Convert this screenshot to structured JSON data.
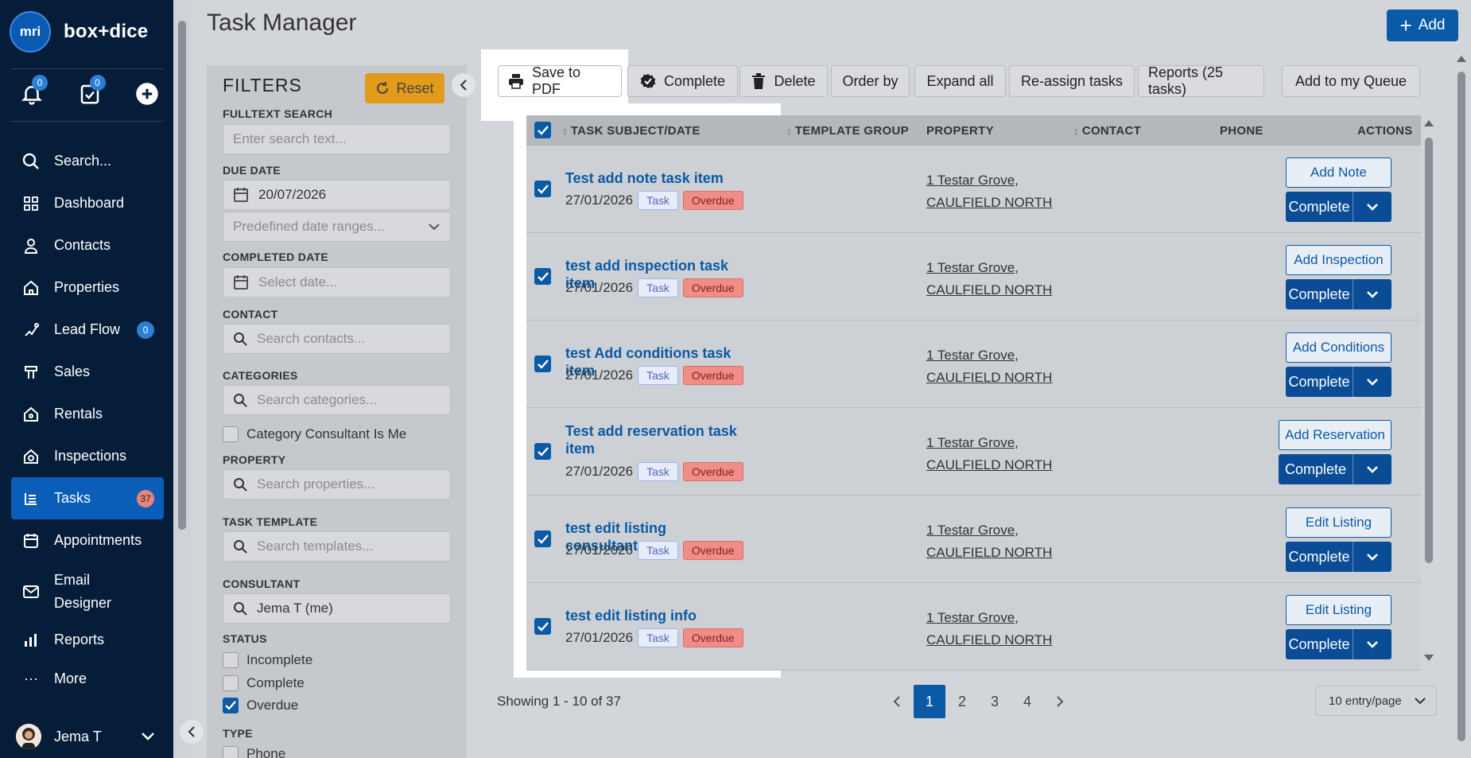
{
  "brand": {
    "logo_text": "mri",
    "name": "box+dice"
  },
  "quick_actions": {
    "notifications_count": "0",
    "tasks_count": "0"
  },
  "nav": [
    {
      "label": "Search...",
      "icon": "search-icon"
    },
    {
      "label": "Dashboard",
      "icon": "grid-icon"
    },
    {
      "label": "Contacts",
      "icon": "person-icon"
    },
    {
      "label": "Properties",
      "icon": "home-icon"
    },
    {
      "label": "Lead Flow",
      "icon": "flow-icon",
      "badge": "0"
    },
    {
      "label": "Sales",
      "icon": "sales-icon"
    },
    {
      "label": "Rentals",
      "icon": "rentals-icon"
    },
    {
      "label": "Inspections",
      "icon": "inspection-icon"
    },
    {
      "label": "Tasks",
      "icon": "tasks-icon",
      "badge": "37",
      "active": true
    },
    {
      "label": "Appointments",
      "icon": "calendar-icon"
    },
    {
      "label": "Email Designer",
      "icon": "mail-icon"
    },
    {
      "label": "Reports",
      "icon": "bar-chart-icon"
    },
    {
      "label": "More",
      "icon": "dots-icon"
    }
  ],
  "user": {
    "name": "Jema T"
  },
  "header": {
    "title": "Task Manager",
    "add_label": "Add"
  },
  "filters": {
    "title": "FILTERS",
    "reset_label": "Reset",
    "fulltext_label": "FULLTEXT SEARCH",
    "fulltext_placeholder": "Enter search text...",
    "due_date_label": "DUE DATE",
    "due_date_value": "20/07/2026",
    "predefined_placeholder": "Predefined date ranges...",
    "completed_date_label": "COMPLETED DATE",
    "completed_date_placeholder": "Select date...",
    "contact_label": "CONTACT",
    "contact_placeholder": "Search contacts...",
    "categories_label": "CATEGORIES",
    "categories_placeholder": "Search categories...",
    "category_consultant_label": "Category Consultant Is Me",
    "property_label": "PROPERTY",
    "property_placeholder": "Search properties...",
    "template_label": "TASK TEMPLATE",
    "template_placeholder": "Search templates...",
    "consultant_label": "CONSULTANT",
    "consultant_value": "Jema T (me)",
    "status_label": "STATUS",
    "status_options": [
      "Incomplete",
      "Complete",
      "Overdue"
    ],
    "status_checked": [
      false,
      false,
      true
    ],
    "type_label": "TYPE",
    "type_first": "Phone"
  },
  "toolbar": {
    "save_pdf": "Save to PDF",
    "complete": "Complete",
    "delete": "Delete",
    "order_by": "Order by",
    "expand_all": "Expand all",
    "reassign": "Re-assign tasks",
    "reports": "Reports (25 tasks)",
    "queue": "Add to my Queue"
  },
  "table": {
    "columns": [
      "TASK SUBJECT/DATE",
      "TEMPLATE GROUP",
      "PROPERTY",
      "CONTACT",
      "PHONE",
      "ACTIONS"
    ],
    "rows": [
      {
        "subject": "Test add note task item",
        "date": "27/01/2026",
        "tag": "Task",
        "status": "Overdue",
        "prop1": "1 Testar Grove,",
        "prop2": "CAULFIELD NORTH",
        "action": "Add Note",
        "complete": "Complete"
      },
      {
        "subject": "test add inspection task item",
        "date": "27/01/2026",
        "tag": "Task",
        "status": "Overdue",
        "prop1": "1 Testar Grove,",
        "prop2": "CAULFIELD NORTH",
        "action": "Add Inspection",
        "complete": "Complete"
      },
      {
        "subject": "test Add conditions task item",
        "date": "27/01/2026",
        "tag": "Task",
        "status": "Overdue",
        "prop1": "1 Testar Grove,",
        "prop2": "CAULFIELD NORTH",
        "action": "Add Conditions",
        "complete": "Complete"
      },
      {
        "subject": "Test add reservation task item",
        "date": "27/01/2026",
        "tag": "Task",
        "status": "Overdue",
        "prop1": "1 Testar Grove,",
        "prop2": "CAULFIELD NORTH",
        "action": "Add Reservation",
        "complete": "Complete"
      },
      {
        "subject": "test edit listing consultants",
        "date": "27/01/2026",
        "tag": "Task",
        "status": "Overdue",
        "prop1": "1 Testar Grove,",
        "prop2": "CAULFIELD NORTH",
        "action": "Edit Listing",
        "complete": "Complete"
      },
      {
        "subject": "test edit listing info",
        "date": "27/01/2026",
        "tag": "Task",
        "status": "Overdue",
        "prop1": "1 Testar Grove,",
        "prop2": "CAULFIELD NORTH",
        "action": "Edit Listing",
        "complete": "Complete"
      }
    ]
  },
  "footer": {
    "showing": "Showing 1 - 10 of 37",
    "pages": [
      "1",
      "2",
      "3",
      "4"
    ],
    "current_page": "1",
    "per_page": "10 entry/page"
  }
}
